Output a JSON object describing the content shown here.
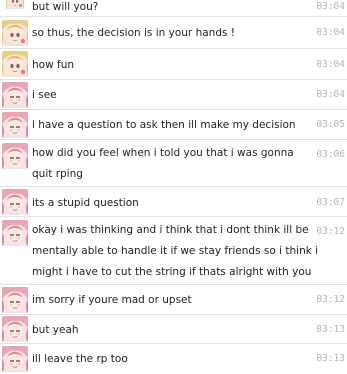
{
  "messages": [
    {
      "text": "but will you?",
      "time": "03:04",
      "avatar": "blonde-avatar"
    },
    {
      "text": "so thus, the decision is in your hands !",
      "time": "03:04",
      "avatar": "blonde-avatar"
    },
    {
      "text": "how fun",
      "time": "03:04",
      "avatar": "blonde-avatar"
    },
    {
      "text": "i see",
      "time": "03:04",
      "avatar": "pink-avatar"
    },
    {
      "text": "i have a question to ask then ill make my decision",
      "time": "03:05",
      "avatar": "pink-avatar"
    },
    {
      "text": "how did you feel when i told you that i was gonna quit rping",
      "time": "03:06",
      "avatar": "pink-avatar"
    },
    {
      "text": "its a stupid question",
      "time": "03:07",
      "avatar": "pink-avatar"
    },
    {
      "text": "okay i was thinking and i think that i dont think ill be mentally able to handle it if we stay friends so i think i might i have to cut the string if thats alright with you",
      "time": "03:12",
      "avatar": "pink-avatar"
    },
    {
      "text": "im sorry if youre mad or upset",
      "time": "03:12",
      "avatar": "pink-avatar"
    },
    {
      "text": "but yeah",
      "time": "03:13",
      "avatar": "pink-avatar"
    },
    {
      "text": "ill leave the rp too",
      "time": "03:13",
      "avatar": "pink-avatar"
    }
  ],
  "colors": {
    "timestamp": "#b4b4b4",
    "divider": "#e2e2e2",
    "text": "#222222"
  }
}
